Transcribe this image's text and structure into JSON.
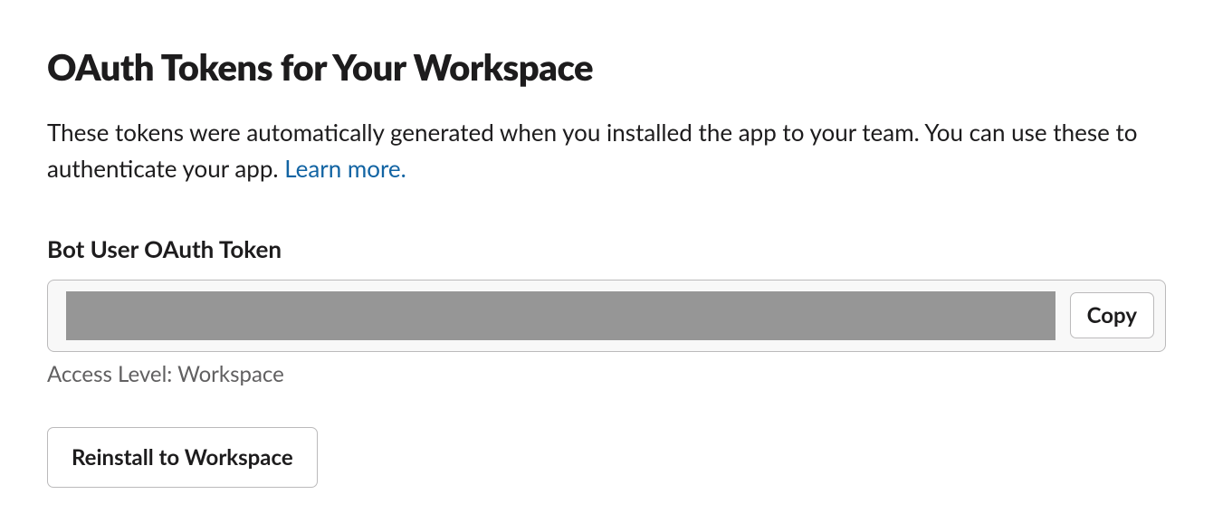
{
  "header": {
    "title": "OAuth Tokens for Your Workspace"
  },
  "description": {
    "text": "These tokens were automatically generated when you installed the app to your team. You can use these to authenticate your app. ",
    "learn_more_label": "Learn more."
  },
  "token_section": {
    "label": "Bot User OAuth Token",
    "copy_label": "Copy",
    "access_level_text": "Access Level: Workspace"
  },
  "actions": {
    "reinstall_label": "Reinstall to Workspace"
  }
}
